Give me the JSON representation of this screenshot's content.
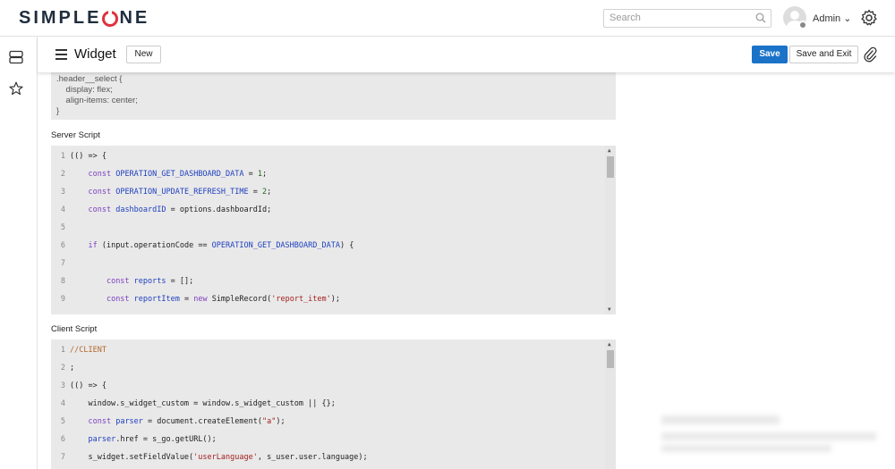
{
  "app": {
    "logo": "SIMPLEONE"
  },
  "header": {
    "search_placeholder": "Search",
    "user_name": "Admin"
  },
  "form": {
    "title": "Widget",
    "new_label": "New",
    "save_label": "Save",
    "save_exit_label": "Save and Exit"
  },
  "css_snippet": [
    ".header__select {",
    "    display: flex;",
    "    align-items: center;",
    "}"
  ],
  "server_script": {
    "label": "Server Script",
    "lines": [
      {
        "n": "1",
        "code": "(() => {"
      },
      {
        "n": "2",
        "code": "    const OPERATION_GET_DASHBOARD_DATA = 1;"
      },
      {
        "n": "3",
        "code": "    const OPERATION_UPDATE_REFRESH_TIME = 2;"
      },
      {
        "n": "4",
        "code": "    const dashboardID = options.dashboardId;"
      },
      {
        "n": "5",
        "code": ""
      },
      {
        "n": "6",
        "code": "    if (input.operationCode == OPERATION_GET_DASHBOARD_DATA) {"
      },
      {
        "n": "7",
        "code": ""
      },
      {
        "n": "8",
        "code": "        const reports = [];"
      },
      {
        "n": "9",
        "code": "        const reportItem = new SimpleRecord('report_item');"
      }
    ]
  },
  "client_script": {
    "label": "Client Script",
    "lines": [
      {
        "n": "1",
        "code": "//CLIENT"
      },
      {
        "n": "2",
        "code": ";"
      },
      {
        "n": "3",
        "code": "(() => {"
      },
      {
        "n": "4",
        "code": "    window.s_widget_custom = window.s_widget_custom || {};"
      },
      {
        "n": "5",
        "code": "    const parser = document.createElement(\"a\");"
      },
      {
        "n": "6",
        "code": "    parser.href = s_go.getURL();"
      },
      {
        "n": "7",
        "code": "    s_widget.setFieldValue('userLanguage', s_user.user.language);"
      }
    ]
  },
  "colors": {
    "primary": "#1a73c8",
    "brand_red": "#e0313b"
  }
}
